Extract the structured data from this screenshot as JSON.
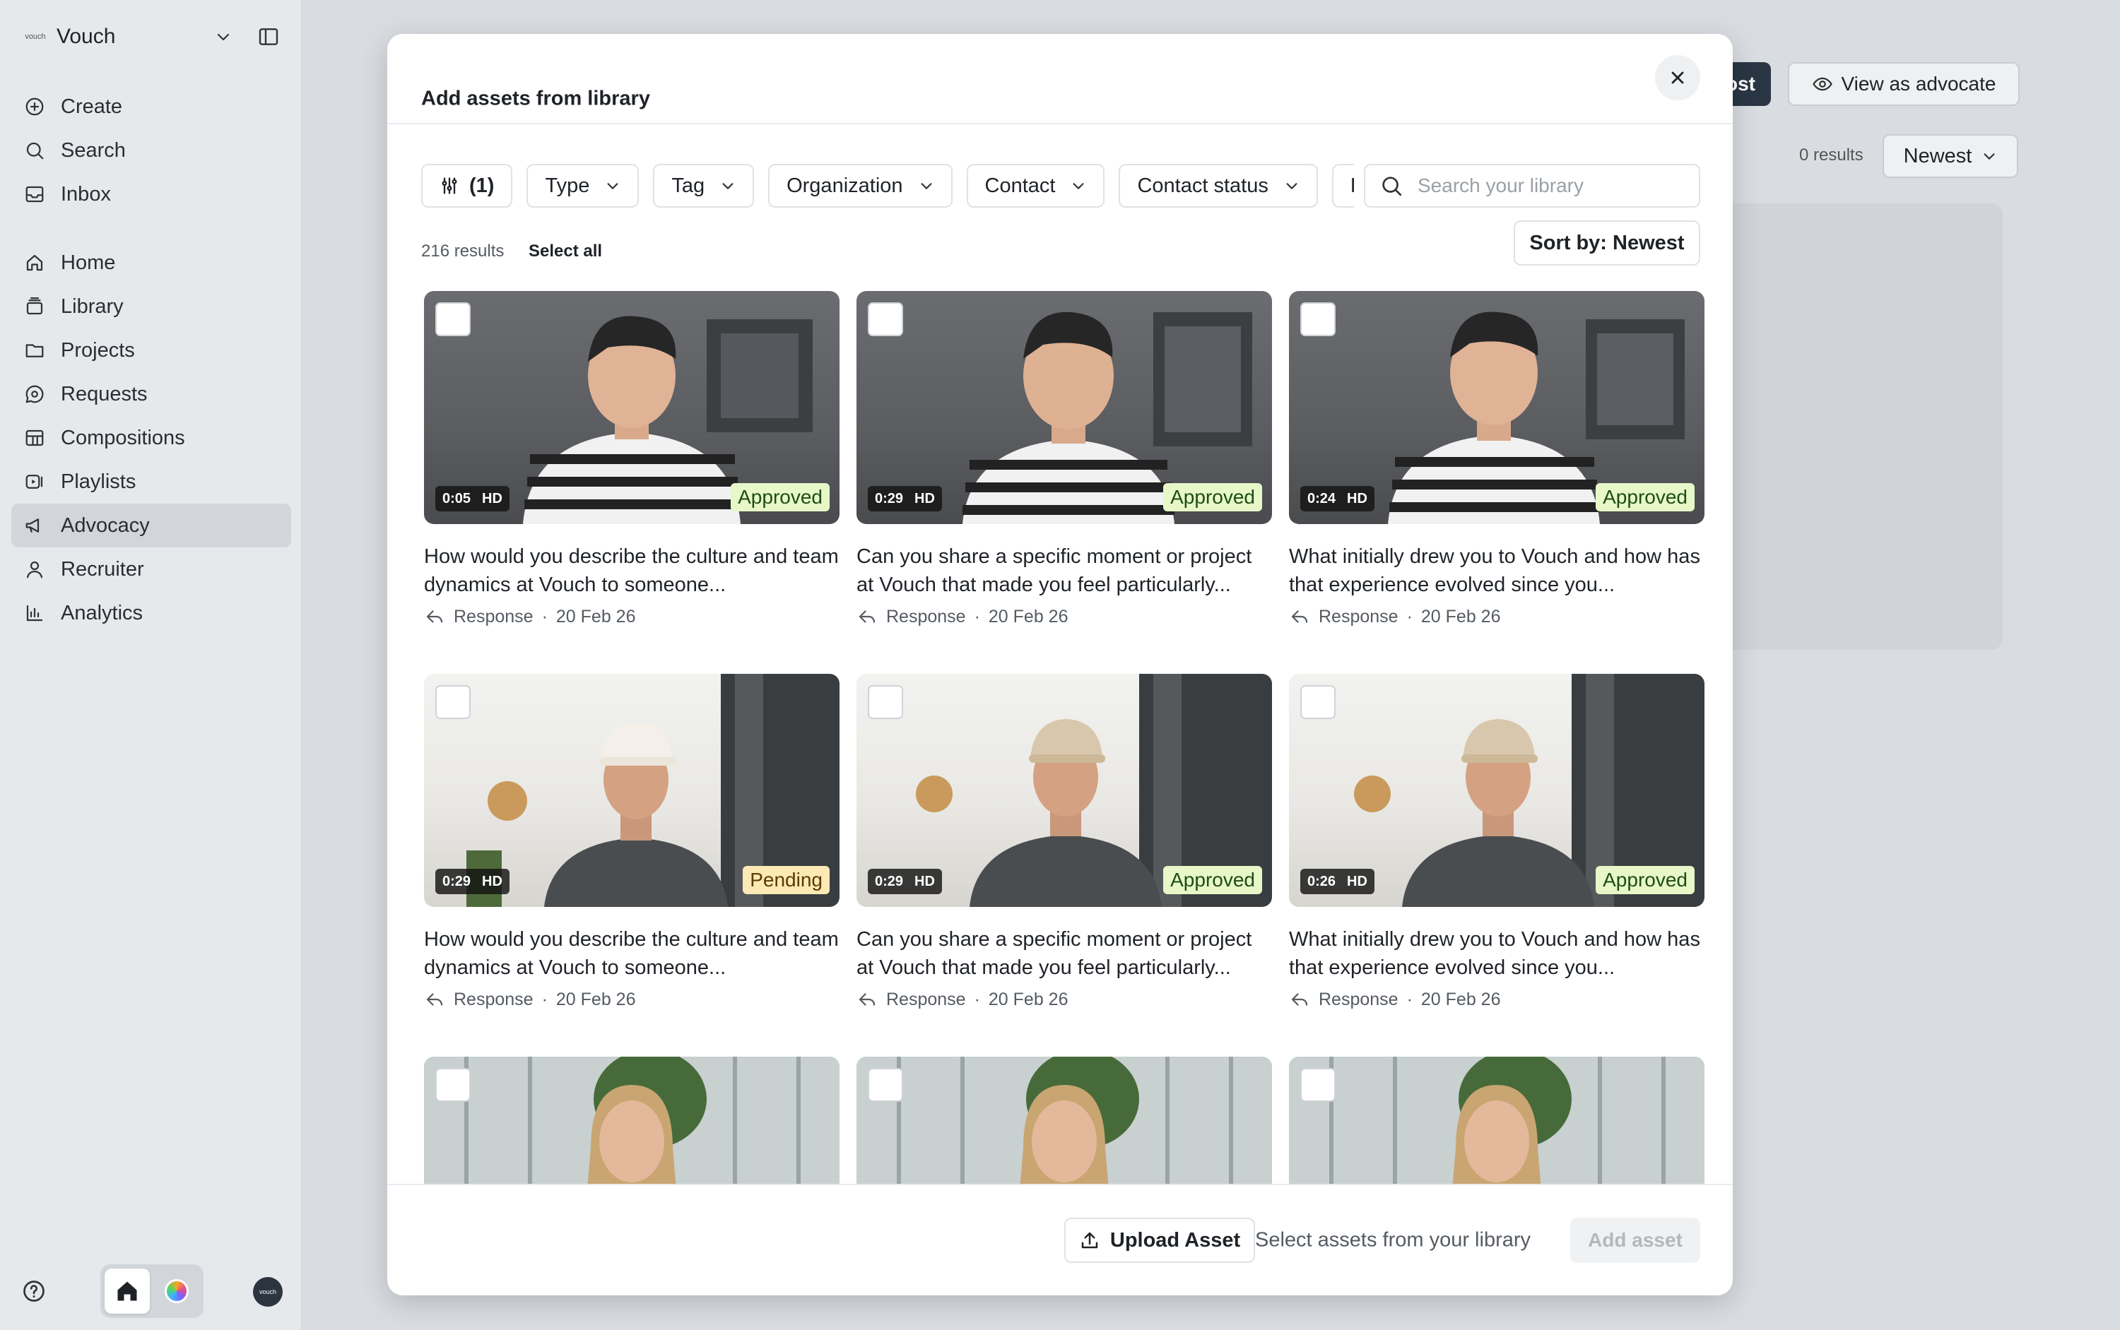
{
  "sidebar": {
    "workspace_logo": "vouch",
    "workspace_name": "Vouch",
    "nav_primary": [
      {
        "label": "Create",
        "icon": "plus-circle-icon"
      },
      {
        "label": "Search",
        "icon": "search-icon"
      },
      {
        "label": "Inbox",
        "icon": "inbox-icon"
      }
    ],
    "nav_main": [
      {
        "label": "Home",
        "icon": "home-icon"
      },
      {
        "label": "Library",
        "icon": "library-icon"
      },
      {
        "label": "Projects",
        "icon": "folder-icon"
      },
      {
        "label": "Requests",
        "icon": "chat-icon"
      },
      {
        "label": "Compositions",
        "icon": "compositions-icon"
      },
      {
        "label": "Playlists",
        "icon": "playlist-icon"
      },
      {
        "label": "Advocacy",
        "icon": "megaphone-icon",
        "active": true
      },
      {
        "label": "Recruiter",
        "icon": "person-icon"
      },
      {
        "label": "Analytics",
        "icon": "chart-icon"
      }
    ],
    "avatar_text": "vouch"
  },
  "background": {
    "primary_button_fragment": "ost",
    "view_as_advocate": "View as advocate",
    "results": "0 results",
    "sort": "Newest"
  },
  "modal": {
    "title": "Add assets from library",
    "filter_count": "(1)",
    "filters": [
      "Type",
      "Tag",
      "Organization",
      "Contact",
      "Contact status",
      "L"
    ],
    "search_placeholder": "Search your library",
    "results": "216 results",
    "select_all": "Select all",
    "sort": "Sort by: Newest",
    "assets": [
      {
        "duration": "0:05",
        "quality": "HD",
        "status": "Approved",
        "title": "How would you describe the culture and team dynamics at Vouch to someone...",
        "kind": "Response",
        "date": "20 Feb 26",
        "scene": "dark"
      },
      {
        "duration": "0:29",
        "quality": "HD",
        "status": "Approved",
        "title": "Can you share a specific moment or project at Vouch that made you feel particularly...",
        "kind": "Response",
        "date": "20 Feb 26",
        "scene": "dark"
      },
      {
        "duration": "0:24",
        "quality": "HD",
        "status": "Approved",
        "title": "What initially drew you to Vouch and how has that experience evolved since you...",
        "kind": "Response",
        "date": "20 Feb 26",
        "scene": "dark"
      },
      {
        "duration": "0:29",
        "quality": "HD",
        "status": "Pending",
        "title": "How would you describe the culture and team dynamics at Vouch to someone...",
        "kind": "Response",
        "date": "20 Feb 26",
        "scene": "bright"
      },
      {
        "duration": "0:29",
        "quality": "HD",
        "status": "Approved",
        "title": "Can you share a specific moment or project at Vouch that made you feel particularly...",
        "kind": "Response",
        "date": "20 Feb 26",
        "scene": "bright"
      },
      {
        "duration": "0:26",
        "quality": "HD",
        "status": "Approved",
        "title": "What initially drew you to Vouch and how has that experience evolved since you...",
        "kind": "Response",
        "date": "20 Feb 26",
        "scene": "bright"
      },
      {
        "duration": "",
        "quality": "",
        "status": "",
        "title": "",
        "kind": "",
        "date": "",
        "scene": "office"
      },
      {
        "duration": "",
        "quality": "",
        "status": "",
        "title": "",
        "kind": "",
        "date": "",
        "scene": "office"
      },
      {
        "duration": "",
        "quality": "",
        "status": "",
        "title": "",
        "kind": "",
        "date": "",
        "scene": "office"
      }
    ],
    "upload_label": "Upload Asset",
    "footer_hint": "Select assets from your library",
    "add_label": "Add asset"
  }
}
